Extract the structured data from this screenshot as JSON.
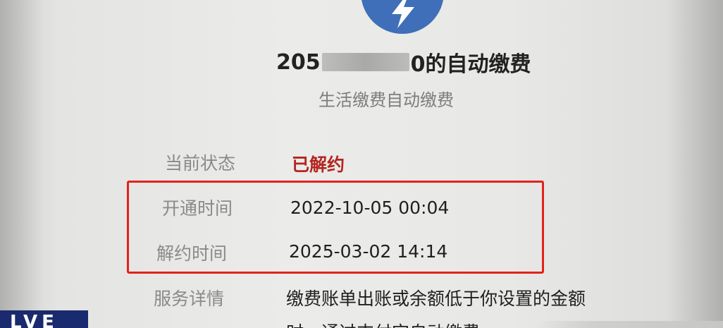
{
  "header": {
    "account_prefix": "205",
    "account_suffix": "0的自动缴费",
    "subtitle": "生活缴费自动缴费"
  },
  "details": {
    "status_label": "当前状态",
    "status_value": "已解约",
    "opened_label": "开通时间",
    "opened_value": "2022-10-05 00:04",
    "cancelled_label": "解约时间",
    "cancelled_value": "2025-03-02 14:14",
    "service_label": "服务详情",
    "service_text_line1": "缴费账单出账或余额低于你设置的金额",
    "service_text_line2": "时，通过支付宝自动缴费"
  },
  "watermark": {
    "text": "LVE"
  },
  "colors": {
    "logo_blue": "#3f6fb8",
    "status_red": "#b3261e",
    "highlight_red": "#e2231a",
    "watermark_navy": "#1a2a6e"
  },
  "icons": {
    "logo": "lightning-bolt-icon"
  }
}
